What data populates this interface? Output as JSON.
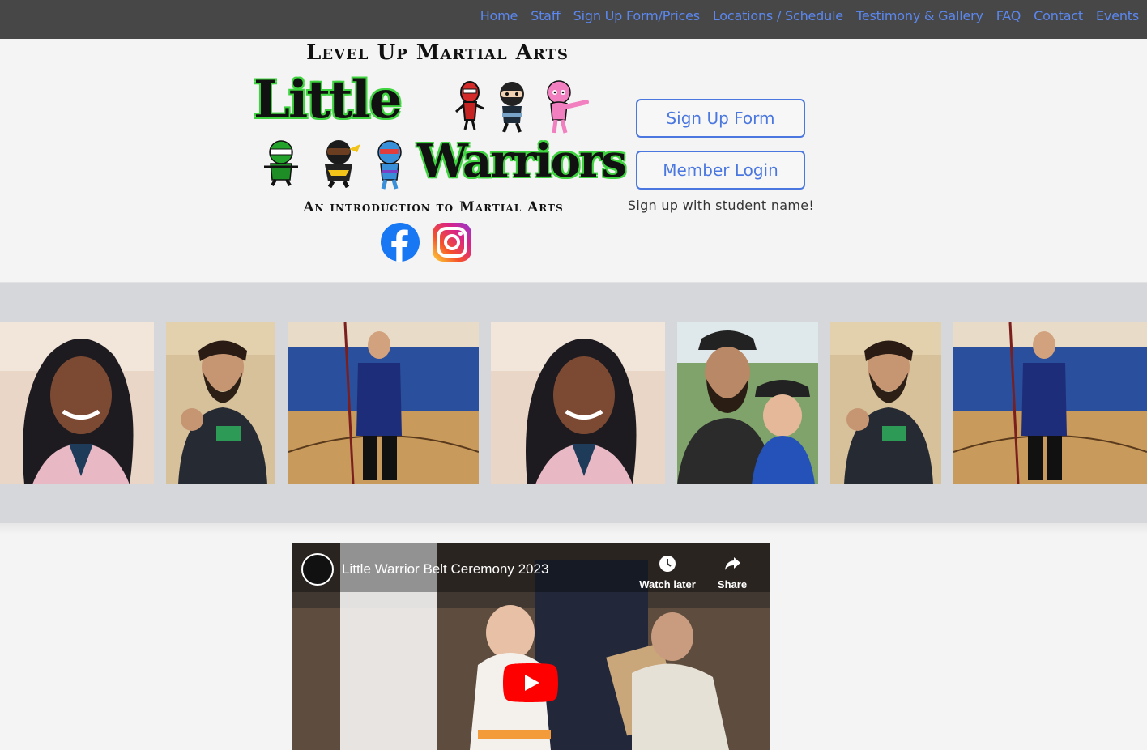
{
  "nav": {
    "items": [
      {
        "label": "Home"
      },
      {
        "label": "Staff"
      },
      {
        "label": "Sign Up Form/Prices"
      },
      {
        "label": "Locations / Schedule"
      },
      {
        "label": "Testimony & Gallery"
      },
      {
        "label": "FAQ"
      },
      {
        "label": "Contact"
      },
      {
        "label": "Events"
      }
    ]
  },
  "logo": {
    "top_line": "Level Up Martial Arts",
    "little": "Little",
    "warriors": "Warriors",
    "sub_line": "An introduction to Martial Arts"
  },
  "social": {
    "facebook": "facebook-icon",
    "instagram": "instagram-icon"
  },
  "actions": {
    "signup_label": "Sign Up Form",
    "login_label": "Member Login",
    "hint": "Sign up with student name!"
  },
  "video": {
    "title": "Little Warrior Belt Ceremony 2023",
    "watch_later": "Watch later",
    "share": "Share"
  },
  "colors": {
    "nav_bg": "#474747",
    "link": "#5b87ee",
    "gallery_bg": "#d6d7db",
    "logo_green": "#3fd43f"
  }
}
